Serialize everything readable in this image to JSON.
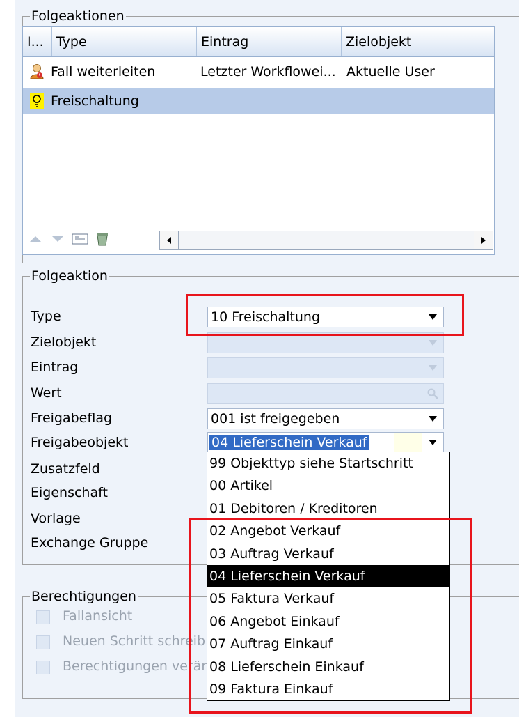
{
  "folgeaktionen": {
    "legend": "Folgeaktionen",
    "columns": [
      "I...",
      "Type",
      "Eintrag",
      "Zielobjekt"
    ],
    "rows": [
      {
        "icon": "user-forward-icon",
        "type": "Fall weiterleiten",
        "eintrag": "Letzter Workflowei...",
        "ziel": "Aktuelle User"
      },
      {
        "icon": "lightbulb-icon",
        "type": "Freischaltung",
        "eintrag": "",
        "ziel": ""
      }
    ]
  },
  "folgeaktion": {
    "legend": "Folgeaktion",
    "labels": {
      "type": "Type",
      "zielobjekt": "Zielobjekt",
      "eintrag": "Eintrag",
      "wert": "Wert",
      "freigabeflag": "Freigabeflag",
      "freigabeobjekt": "Freigabeobjekt",
      "zusatzfeld": "Zusatzfeld",
      "eigenschaft": "Eigenschaft",
      "vorlage": "Vorlage",
      "exchange": "Exchange Gruppe"
    },
    "values": {
      "type": "10 Freischaltung",
      "freigabeflag": "001 ist freigegeben",
      "freigabeobjekt": "04 Lieferschein Verkauf"
    }
  },
  "dropdown_options": [
    "99 Objekttyp siehe Startschritt",
    "00 Artikel",
    "01 Debitoren / Kreditoren",
    "02 Angebot Verkauf",
    "03 Auftrag Verkauf",
    "04 Lieferschein Verkauf",
    "05 Faktura Verkauf",
    "06 Angebot Einkauf",
    "07 Auftrag Einkauf",
    "08 Lieferschein Einkauf",
    "09 Faktura Einkauf"
  ],
  "dropdown_selected_index": 5,
  "berechtigungen": {
    "legend": "Berechtigungen",
    "items": [
      "Fallansicht",
      "Neuen Schritt schreib",
      "Berechtigungen verär"
    ]
  },
  "colors": {
    "highlight_red": "#e8141c",
    "selection_blue": "#316ac5",
    "panel_bg": "#eef3fa"
  }
}
